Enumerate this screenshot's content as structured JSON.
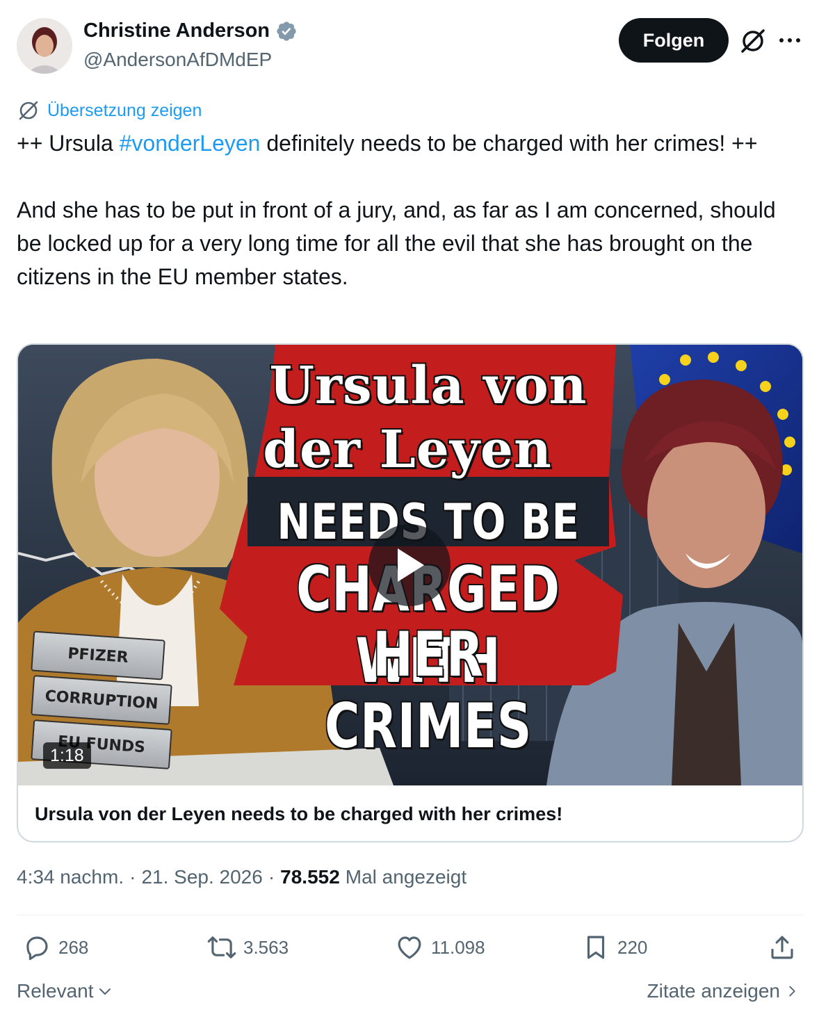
{
  "author": {
    "display_name": "Christine Anderson",
    "handle": "@AndersonAfDMdEP",
    "verified_badge_color": "#829aab"
  },
  "header": {
    "follow_label": "Folgen",
    "grok_icon": "grok-icon",
    "more_icon": "more-icon"
  },
  "translate": {
    "label": "Übersetzung zeigen"
  },
  "tweet": {
    "text_before_hashtag": "++ Ursula ",
    "hashtag": "#vonderLeyen",
    "text_after_hashtag": " definitely needs to be charged with her crimes! ++\n\nAnd she has to be put in front of a jury, and, as far as I am concerned, should be locked up for a very long time for all the evil that she has brought on the citizens in the EU member states."
  },
  "card": {
    "thumbnail": {
      "headline_line1": "Ursula von",
      "headline_line2": "der Leyen",
      "headline_line3": "NEEDS TO BE",
      "headline_line4": "CHARGED WITH",
      "headline_line5": "HER CRIMES",
      "binders": [
        "PFIZER",
        "CORRUPTION",
        "EU FUNDS"
      ]
    },
    "duration": "1:18",
    "title": "Ursula von der Leyen needs to be charged with her crimes!"
  },
  "meta": {
    "time": "4:34 nachm.",
    "separator": "·",
    "date": "21. Sep. 2026",
    "views_count": "78.552",
    "views_label": "Mal angezeigt"
  },
  "actions": {
    "replies": "268",
    "reposts": "3.563",
    "likes": "11.098",
    "bookmarks": "220"
  },
  "footer": {
    "sort_label": "Relevant",
    "quotes_label": "Zitate anzeigen"
  },
  "colors": {
    "accent": "#1d9bf0",
    "text_primary": "#0f1419",
    "text_secondary": "#536471",
    "headline_red": "#c41d1d"
  }
}
